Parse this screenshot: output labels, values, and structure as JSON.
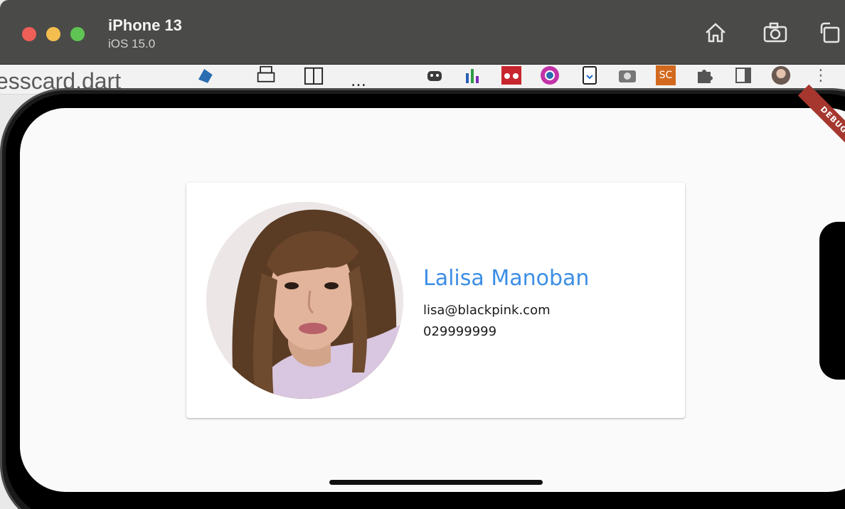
{
  "simulator": {
    "device_name": "iPhone 13",
    "os_version": "iOS 15.0",
    "toolbar": {
      "home_icon": "home-icon",
      "screenshot_icon": "camera-icon",
      "rotate_icon": "rotate-icon"
    }
  },
  "ide": {
    "tab_filename": "esscard.dart",
    "more_label": "…",
    "plugin_sc_label": "SC"
  },
  "app": {
    "debug_banner": "DEBUG",
    "profile": {
      "name": "Lalisa Manoban",
      "email": "lisa@blackpink.com",
      "phone": "029999999"
    }
  },
  "colors": {
    "accent": "#3c8ee6",
    "debug_banner": "#a5372f",
    "traffic_red": "#ee5f57",
    "traffic_yellow": "#f4be4f",
    "traffic_green": "#5fc454"
  }
}
